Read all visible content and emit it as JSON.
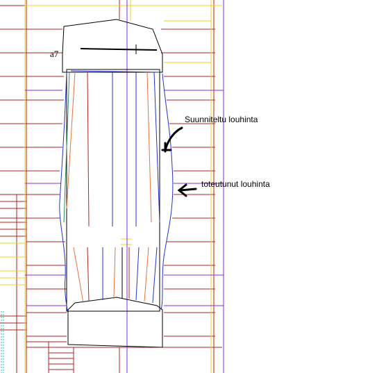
{
  "labels": {
    "section_id": "a7",
    "planned": "Suunniteltu louhinta",
    "actual": "toteutunut louhinta"
  },
  "colors": {
    "background": "#ffffff",
    "grid_red": "#b22222",
    "grid_yellow": "#f2d21c",
    "grid_purple": "#8a2be2",
    "outline_black": "#000000",
    "outline_blue": "#2233cc",
    "hole_orange": "#e8743a",
    "hole_green": "#2e8b57",
    "edge_cyan": "#22bbcc"
  }
}
